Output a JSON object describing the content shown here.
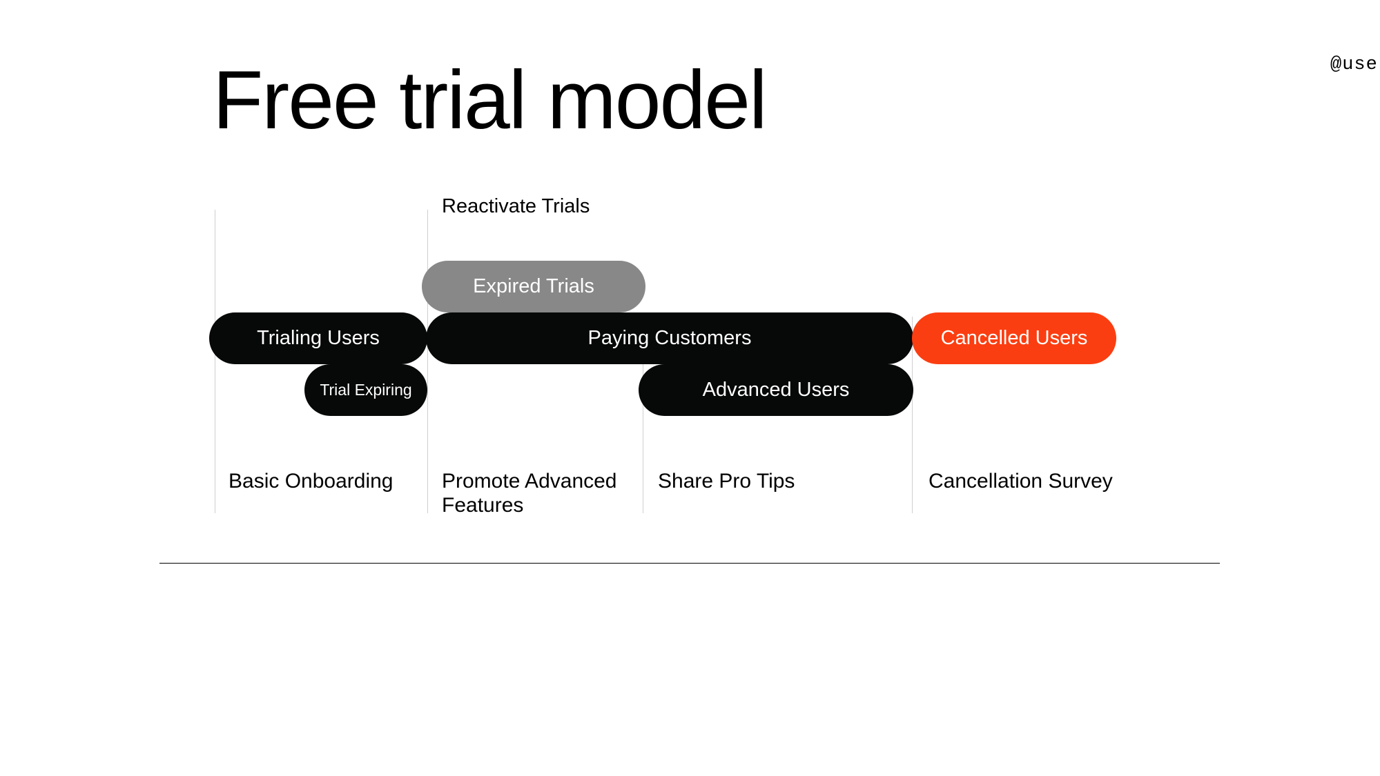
{
  "handle": "@userlist",
  "title": "Free trial model",
  "labels": {
    "reactivate": "Reactivate Trials",
    "basic": "Basic Onboarding",
    "promote": "Promote Advanced Features",
    "protips": "Share Pro Tips",
    "cancelsur": "Cancellation Survey"
  },
  "pills": {
    "trialing": "Trialing Users",
    "paying": "Paying Customers",
    "cancelled": "Cancelled Users",
    "expired": "Expired Trials",
    "advanced": "Advanced Users",
    "expiring": "Trial Expiring"
  },
  "colors": {
    "black": "#070808",
    "gray": "#888888",
    "orange": "#fb3e11",
    "vline": "#cfcfcf"
  }
}
